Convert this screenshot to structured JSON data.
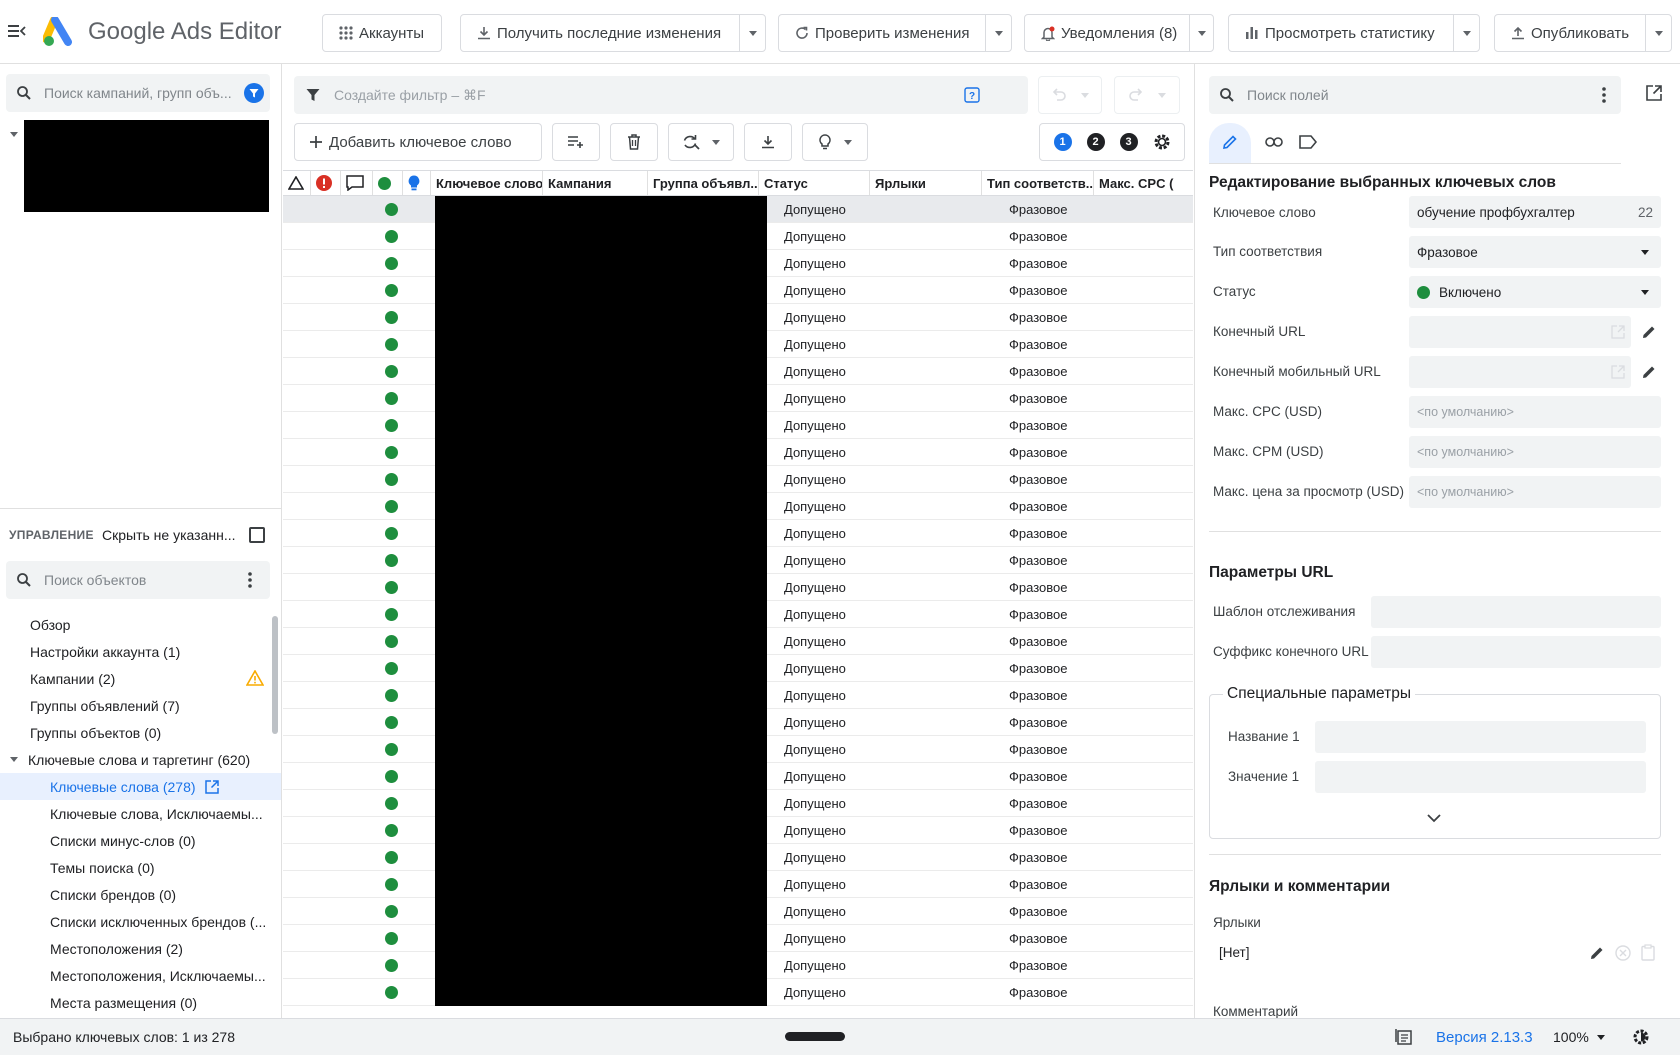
{
  "app": {
    "title": "Google Ads Editor"
  },
  "toolbar": {
    "accounts": "Аккаунты",
    "get_changes": "Получить последние изменения",
    "check_changes": "Проверить изменения",
    "notifications": "Уведомления (8)",
    "view_stats": "Просмотреть статистику",
    "publish": "Опубликовать"
  },
  "left": {
    "search_placeholder": "Поиск кампаний, групп объ...",
    "manage_label": "УПРАВЛЕНИЕ",
    "hide_unspecified": "Скрыть не указанн...",
    "objects_search_placeholder": "Поиск объектов",
    "tree": [
      "Обзор",
      "Настройки аккаунта (1)",
      "Кампании (2)",
      "Группы объявлений (7)",
      "Группы объектов (0)",
      "Ключевые слова и таргетинг (620)",
      "Ключевые слова (278)",
      "Ключевые слова, Исключаемы...",
      "Списки минус-слов (0)",
      "Темы поиска (0)",
      "Списки брендов (0)",
      "Списки исключенных брендов (...",
      "Местоположения (2)",
      "Местоположения, Исключаемы...",
      "Места размещения (0)"
    ]
  },
  "center": {
    "filter_placeholder": "Создайте фильтр – ⌘F",
    "add_keyword": "Добавить ключевое слово",
    "view_numbers": [
      "1",
      "2",
      "3"
    ],
    "columns": {
      "keyword": "Ключевое слово",
      "campaign": "Кампания",
      "adgroup": "Группа объявл...",
      "status": "Статус",
      "labels": "Ярлыки",
      "match_type": "Тип соответств...",
      "max_cpc": "Макс. CPC ("
    },
    "row_status": "Допущено",
    "row_match": "Фразовое",
    "row_count": 30
  },
  "right": {
    "search_placeholder": "Поиск полей",
    "edit_title": "Редактирование выбранных ключевых слов",
    "fields": {
      "keyword_label": "Ключевое слово",
      "keyword_value": "обучение профбухгалтер",
      "keyword_length": "22",
      "match_label": "Тип соответствия",
      "match_value": "Фразовое",
      "status_label": "Статус",
      "status_value": "Включено",
      "final_url_label": "Конечный URL",
      "final_mobile_url_label": "Конечный мобильный URL",
      "max_cpc_label": "Макс. CPC (USD)",
      "max_cpm_label": "Макс. CPM (USD)",
      "max_cpv_label": "Макс. цена за просмотр (USD)",
      "default_placeholder": "<по умолчанию>"
    },
    "url_params_title": "Параметры URL",
    "tracking_template_label": "Шаблон отслеживания",
    "final_url_suffix_label": "Суффикс конечного URL",
    "custom_params_title": "Специальные параметры",
    "name1_label": "Название 1",
    "value1_label": "Значение 1",
    "labels_comments_title": "Ярлыки и комментарии",
    "labels_label": "Ярлыки",
    "labels_value": "[Нет]",
    "comment_label": "Комментарий"
  },
  "status": {
    "selected": "Выбрано ключевых слов: 1 из 278",
    "version": "Версия 2.13.3",
    "zoom": "100%"
  },
  "colors": {
    "accent": "#1a73e8",
    "enabled_green": "#1e8e3e",
    "error_red": "#d93025",
    "warning_yellow": "#f9ab00"
  }
}
